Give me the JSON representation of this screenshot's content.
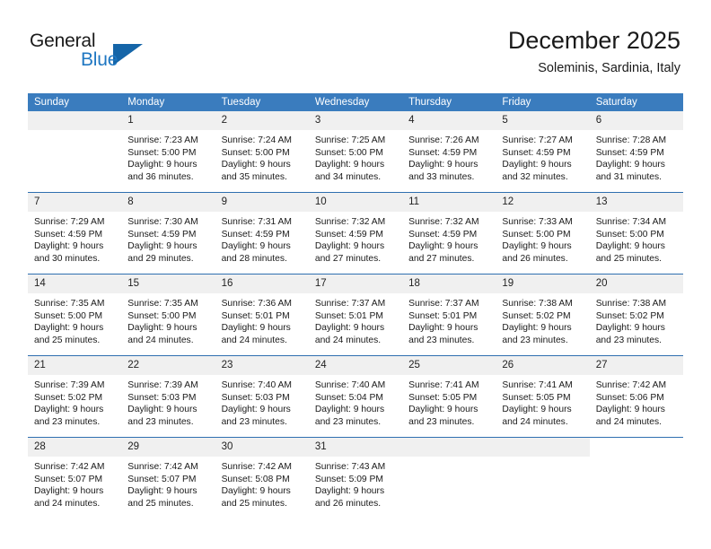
{
  "logo": {
    "text_primary": "General",
    "text_secondary": "Blue",
    "accent_color": "#1565a8",
    "secondary_color": "#1f77c2"
  },
  "header": {
    "title": "December 2025",
    "subtitle": "Soleminis, Sardinia, Italy"
  },
  "theme": {
    "header_row_bg": "#3a7cbe",
    "daynum_bg": "#f0f0f0",
    "row_divider": "#2f6fb0"
  },
  "calendar": {
    "weekday_headers": [
      "Sunday",
      "Monday",
      "Tuesday",
      "Wednesday",
      "Thursday",
      "Friday",
      "Saturday"
    ],
    "weeks": [
      [
        {
          "day": "",
          "empty": true
        },
        {
          "day": "1",
          "sunrise": "Sunrise: 7:23 AM",
          "sunset": "Sunset: 5:00 PM",
          "daylight_line1": "Daylight: 9 hours",
          "daylight_line2": "and 36 minutes."
        },
        {
          "day": "2",
          "sunrise": "Sunrise: 7:24 AM",
          "sunset": "Sunset: 5:00 PM",
          "daylight_line1": "Daylight: 9 hours",
          "daylight_line2": "and 35 minutes."
        },
        {
          "day": "3",
          "sunrise": "Sunrise: 7:25 AM",
          "sunset": "Sunset: 5:00 PM",
          "daylight_line1": "Daylight: 9 hours",
          "daylight_line2": "and 34 minutes."
        },
        {
          "day": "4",
          "sunrise": "Sunrise: 7:26 AM",
          "sunset": "Sunset: 4:59 PM",
          "daylight_line1": "Daylight: 9 hours",
          "daylight_line2": "and 33 minutes."
        },
        {
          "day": "5",
          "sunrise": "Sunrise: 7:27 AM",
          "sunset": "Sunset: 4:59 PM",
          "daylight_line1": "Daylight: 9 hours",
          "daylight_line2": "and 32 minutes."
        },
        {
          "day": "6",
          "sunrise": "Sunrise: 7:28 AM",
          "sunset": "Sunset: 4:59 PM",
          "daylight_line1": "Daylight: 9 hours",
          "daylight_line2": "and 31 minutes."
        }
      ],
      [
        {
          "day": "7",
          "sunrise": "Sunrise: 7:29 AM",
          "sunset": "Sunset: 4:59 PM",
          "daylight_line1": "Daylight: 9 hours",
          "daylight_line2": "and 30 minutes."
        },
        {
          "day": "8",
          "sunrise": "Sunrise: 7:30 AM",
          "sunset": "Sunset: 4:59 PM",
          "daylight_line1": "Daylight: 9 hours",
          "daylight_line2": "and 29 minutes."
        },
        {
          "day": "9",
          "sunrise": "Sunrise: 7:31 AM",
          "sunset": "Sunset: 4:59 PM",
          "daylight_line1": "Daylight: 9 hours",
          "daylight_line2": "and 28 minutes."
        },
        {
          "day": "10",
          "sunrise": "Sunrise: 7:32 AM",
          "sunset": "Sunset: 4:59 PM",
          "daylight_line1": "Daylight: 9 hours",
          "daylight_line2": "and 27 minutes."
        },
        {
          "day": "11",
          "sunrise": "Sunrise: 7:32 AM",
          "sunset": "Sunset: 4:59 PM",
          "daylight_line1": "Daylight: 9 hours",
          "daylight_line2": "and 27 minutes."
        },
        {
          "day": "12",
          "sunrise": "Sunrise: 7:33 AM",
          "sunset": "Sunset: 5:00 PM",
          "daylight_line1": "Daylight: 9 hours",
          "daylight_line2": "and 26 minutes."
        },
        {
          "day": "13",
          "sunrise": "Sunrise: 7:34 AM",
          "sunset": "Sunset: 5:00 PM",
          "daylight_line1": "Daylight: 9 hours",
          "daylight_line2": "and 25 minutes."
        }
      ],
      [
        {
          "day": "14",
          "sunrise": "Sunrise: 7:35 AM",
          "sunset": "Sunset: 5:00 PM",
          "daylight_line1": "Daylight: 9 hours",
          "daylight_line2": "and 25 minutes."
        },
        {
          "day": "15",
          "sunrise": "Sunrise: 7:35 AM",
          "sunset": "Sunset: 5:00 PM",
          "daylight_line1": "Daylight: 9 hours",
          "daylight_line2": "and 24 minutes."
        },
        {
          "day": "16",
          "sunrise": "Sunrise: 7:36 AM",
          "sunset": "Sunset: 5:01 PM",
          "daylight_line1": "Daylight: 9 hours",
          "daylight_line2": "and 24 minutes."
        },
        {
          "day": "17",
          "sunrise": "Sunrise: 7:37 AM",
          "sunset": "Sunset: 5:01 PM",
          "daylight_line1": "Daylight: 9 hours",
          "daylight_line2": "and 24 minutes."
        },
        {
          "day": "18",
          "sunrise": "Sunrise: 7:37 AM",
          "sunset": "Sunset: 5:01 PM",
          "daylight_line1": "Daylight: 9 hours",
          "daylight_line2": "and 23 minutes."
        },
        {
          "day": "19",
          "sunrise": "Sunrise: 7:38 AM",
          "sunset": "Sunset: 5:02 PM",
          "daylight_line1": "Daylight: 9 hours",
          "daylight_line2": "and 23 minutes."
        },
        {
          "day": "20",
          "sunrise": "Sunrise: 7:38 AM",
          "sunset": "Sunset: 5:02 PM",
          "daylight_line1": "Daylight: 9 hours",
          "daylight_line2": "and 23 minutes."
        }
      ],
      [
        {
          "day": "21",
          "sunrise": "Sunrise: 7:39 AM",
          "sunset": "Sunset: 5:02 PM",
          "daylight_line1": "Daylight: 9 hours",
          "daylight_line2": "and 23 minutes."
        },
        {
          "day": "22",
          "sunrise": "Sunrise: 7:39 AM",
          "sunset": "Sunset: 5:03 PM",
          "daylight_line1": "Daylight: 9 hours",
          "daylight_line2": "and 23 minutes."
        },
        {
          "day": "23",
          "sunrise": "Sunrise: 7:40 AM",
          "sunset": "Sunset: 5:03 PM",
          "daylight_line1": "Daylight: 9 hours",
          "daylight_line2": "and 23 minutes."
        },
        {
          "day": "24",
          "sunrise": "Sunrise: 7:40 AM",
          "sunset": "Sunset: 5:04 PM",
          "daylight_line1": "Daylight: 9 hours",
          "daylight_line2": "and 23 minutes."
        },
        {
          "day": "25",
          "sunrise": "Sunrise: 7:41 AM",
          "sunset": "Sunset: 5:05 PM",
          "daylight_line1": "Daylight: 9 hours",
          "daylight_line2": "and 23 minutes."
        },
        {
          "day": "26",
          "sunrise": "Sunrise: 7:41 AM",
          "sunset": "Sunset: 5:05 PM",
          "daylight_line1": "Daylight: 9 hours",
          "daylight_line2": "and 24 minutes."
        },
        {
          "day": "27",
          "sunrise": "Sunrise: 7:42 AM",
          "sunset": "Sunset: 5:06 PM",
          "daylight_line1": "Daylight: 9 hours",
          "daylight_line2": "and 24 minutes."
        }
      ],
      [
        {
          "day": "28",
          "sunrise": "Sunrise: 7:42 AM",
          "sunset": "Sunset: 5:07 PM",
          "daylight_line1": "Daylight: 9 hours",
          "daylight_line2": "and 24 minutes."
        },
        {
          "day": "29",
          "sunrise": "Sunrise: 7:42 AM",
          "sunset": "Sunset: 5:07 PM",
          "daylight_line1": "Daylight: 9 hours",
          "daylight_line2": "and 25 minutes."
        },
        {
          "day": "30",
          "sunrise": "Sunrise: 7:42 AM",
          "sunset": "Sunset: 5:08 PM",
          "daylight_line1": "Daylight: 9 hours",
          "daylight_line2": "and 25 minutes."
        },
        {
          "day": "31",
          "sunrise": "Sunrise: 7:43 AM",
          "sunset": "Sunset: 5:09 PM",
          "daylight_line1": "Daylight: 9 hours",
          "daylight_line2": "and 26 minutes."
        },
        {
          "day": "",
          "empty": true
        },
        {
          "day": "",
          "empty": true
        },
        {
          "day": "",
          "empty": true,
          "no_band": true
        }
      ]
    ]
  }
}
